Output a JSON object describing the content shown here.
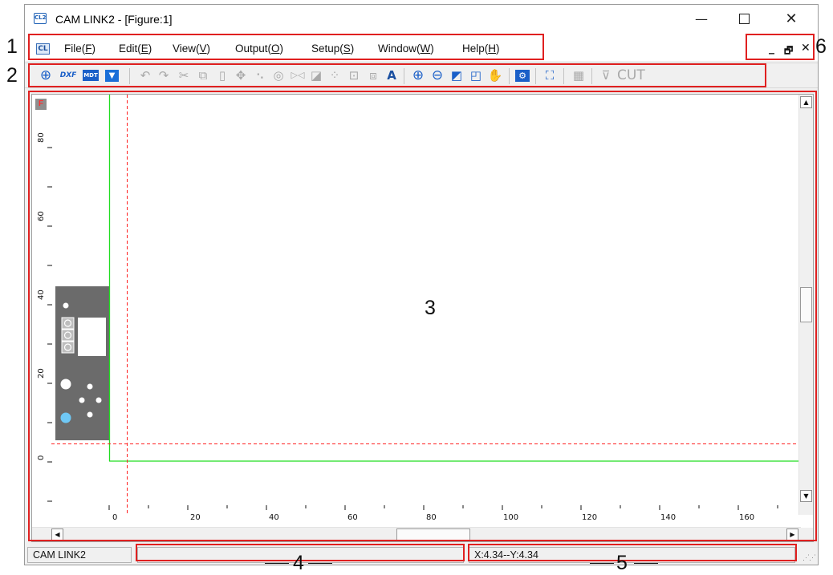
{
  "window": {
    "title": "CAM LINK2 - [Figure:1]",
    "app_icon_text": "CL2",
    "controls": {
      "minimize": "—",
      "close": "✕"
    }
  },
  "menu": {
    "icon_text": "CL",
    "items": [
      {
        "prefix": "File(",
        "key": "F",
        "suffix": ")"
      },
      {
        "prefix": "Edit(",
        "key": "E",
        "suffix": ")"
      },
      {
        "prefix": "View(",
        "key": "V",
        "suffix": ")"
      },
      {
        "prefix": "Output(",
        "key": "O",
        "suffix": ")"
      },
      {
        "prefix": "Setup(",
        "key": "S",
        "suffix": ")"
      },
      {
        "prefix": "Window(",
        "key": "W",
        "suffix": ")"
      },
      {
        "prefix": "Help(",
        "key": "H",
        "suffix": ")"
      }
    ],
    "mdi_controls": {
      "minimize": "_",
      "restore": "🗗",
      "close": "✕"
    }
  },
  "toolbar": {
    "icons": [
      "add-circle-icon",
      "dxf-import-icon",
      "mdt-import-icon",
      "save-file-icon",
      "undo-icon",
      "redo-icon",
      "cut-icon",
      "copy-icon",
      "paste-icon",
      "move-icon",
      "node-edit-icon",
      "rotate-icon",
      "mirror-icon",
      "scale-icon",
      "array-icon",
      "align-icon",
      "layer-icon",
      "text-icon",
      "zoom-in-icon",
      "zoom-out-icon",
      "zoom-window-icon",
      "zoom-fit-icon",
      "pan-hand-icon",
      "settings-icon",
      "fullscreen-icon",
      "output-icon",
      "cut-icon"
    ],
    "dxf_label": "DXF",
    "mdt_label": "MDT",
    "text_label": "A",
    "cut_label": "CUT"
  },
  "canvas": {
    "corner_badge": "F",
    "x_ticks": [
      "0",
      "20",
      "40",
      "60",
      "80",
      "100",
      "120",
      "140",
      "160"
    ],
    "y_ticks": [
      "80",
      "60",
      "40",
      "20",
      "0"
    ],
    "colors": {
      "material_border": "#22dd22",
      "guide_line": "#ff2020",
      "part_fill": "#6b6b6b",
      "hole_highlight": "#6fc8f5"
    }
  },
  "statusbar": {
    "app_name": "CAM LINK2",
    "message": "",
    "coordinates": "X:4.34--Y:4.34"
  },
  "callouts": {
    "menu_bar": "1",
    "toolbar": "2",
    "drawing_area": "3",
    "status_message": "4",
    "coordinates": "5",
    "mdi_controls": "6"
  }
}
